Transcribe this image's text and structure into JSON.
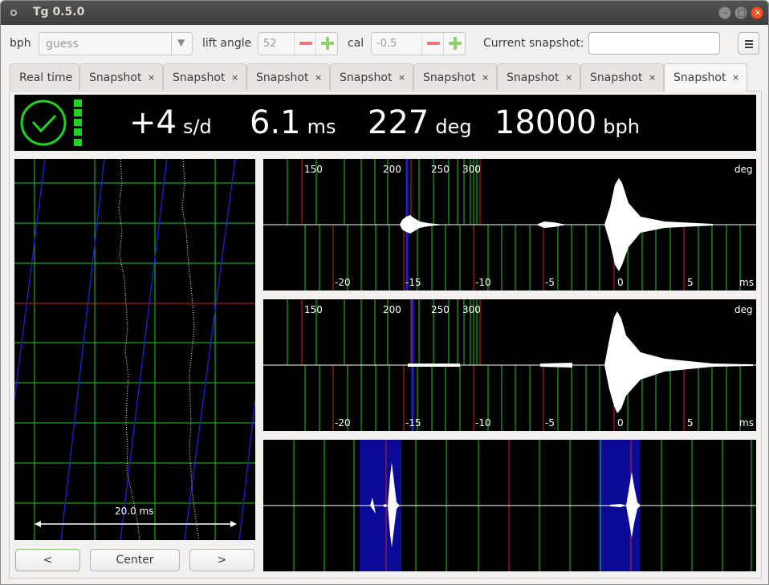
{
  "window": {
    "title": "Tg 0.5.0"
  },
  "toolbar": {
    "bph_label": "bph",
    "bph_value": "guess",
    "lift_angle_label": "lift angle",
    "lift_angle_value": "52",
    "cal_label": "cal",
    "cal_value": "-0.5",
    "snapshot_label": "Current snapshot:",
    "snapshot_value": ""
  },
  "tabs": [
    {
      "label": "Real time",
      "closable": false,
      "active": false
    },
    {
      "label": "Snapshot",
      "closable": true,
      "active": false
    },
    {
      "label": "Snapshot",
      "closable": true,
      "active": false
    },
    {
      "label": "Snapshot",
      "closable": true,
      "active": false
    },
    {
      "label": "Snapshot",
      "closable": true,
      "active": false
    },
    {
      "label": "Snapshot",
      "closable": true,
      "active": false
    },
    {
      "label": "Snapshot",
      "closable": true,
      "active": false
    },
    {
      "label": "Snapshot",
      "closable": true,
      "active": false
    },
    {
      "label": "Snapshot",
      "closable": true,
      "active": true
    }
  ],
  "tab_close_glyph": "×",
  "header": {
    "rate": {
      "value": "+4",
      "unit": "s/d"
    },
    "beat_error": {
      "value": "6.1",
      "unit": "ms"
    },
    "amplitude": {
      "value": "227",
      "unit": "deg"
    },
    "bph": {
      "value": "18000",
      "unit": "bph"
    },
    "status_color": "#1ed41e"
  },
  "paperstrip": {
    "scale_label": "20.0 ms"
  },
  "waveform_tic": {
    "deg_ticks": [
      "150",
      "200",
      "250",
      "300"
    ],
    "deg_unit": "deg",
    "ms_ticks": [
      "-20",
      "-15",
      "-10",
      "-5",
      "0",
      "5"
    ],
    "ms_unit": "ms"
  },
  "waveform_toc": {
    "deg_ticks": [
      "150",
      "200",
      "250",
      "300"
    ],
    "deg_unit": "deg",
    "ms_ticks": [
      "-20",
      "-15",
      "-10",
      "-5",
      "0",
      "5"
    ],
    "ms_unit": "ms"
  },
  "buttons": {
    "left": "<",
    "center": "Center",
    "right": ">"
  },
  "colors": {
    "grid_green": "#1ec81e",
    "grid_red": "#d21e1e",
    "marker_blue": "#1e1edc",
    "highlight_blue": "#0a0a96"
  }
}
